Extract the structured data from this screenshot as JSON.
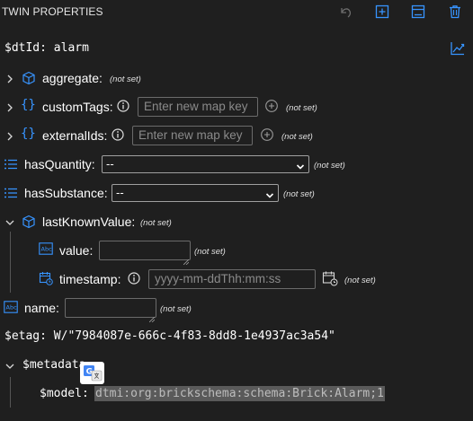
{
  "header": {
    "title": "TWIN PROPERTIES"
  },
  "dtId": {
    "key": "$dtId:",
    "value": "alarm"
  },
  "properties": [
    {
      "name": "aggregate:",
      "status": "(not set)"
    },
    {
      "name": "customTags:",
      "placeholder": "Enter new map key",
      "status": "(not set)"
    },
    {
      "name": "externalIds:",
      "placeholder": "Enter new map key",
      "status": "(not set)"
    },
    {
      "name": "hasQuantity:",
      "selected": "--",
      "status": "(not set)"
    },
    {
      "name": "hasSubstance:",
      "selected": "--",
      "status": "(not set)"
    },
    {
      "name": "lastKnownValue:",
      "status": "(not set)"
    },
    {
      "name": "value:",
      "status": "(not set)"
    },
    {
      "name": "timestamp:",
      "placeholder": "yyyy-mm-ddThh:mm:ss",
      "status": "(not set)"
    },
    {
      "name": "name:",
      "status": "(not set)"
    }
  ],
  "etag": {
    "key": "$etag:",
    "value": "W/\"7984087e-666c-4f83-8dd8-1e4937ac3a54\""
  },
  "metadata": {
    "key": "$metadata",
    "model_key": "$model:",
    "model_value": "dtmi:org:brickschema:schema:Brick:Alarm;1"
  },
  "colors": {
    "background": "#1f1f1f",
    "accent": "#3794ff",
    "text": "#ffffff",
    "muted": "#8a8a8a"
  },
  "icons": {
    "undo": "undo-icon",
    "add": "add-icon",
    "collapse": "collapse-icon",
    "delete": "delete-icon",
    "chart": "chart-icon",
    "cube": "cube-icon",
    "braces": "braces-icon",
    "info": "info-icon",
    "plus-circle": "plus-circle-icon",
    "list": "list-icon",
    "text-field": "text-field-icon",
    "calendar": "calendar-icon",
    "translate": "translate-icon"
  }
}
